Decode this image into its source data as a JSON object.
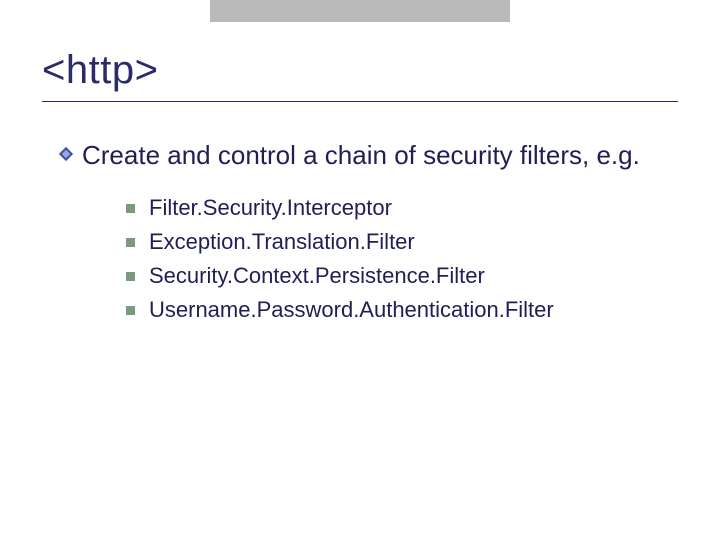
{
  "title": "<http>",
  "bullet_main": "Create and control a chain of security filters, e.g.",
  "sub_items": [
    "Filter.Security.Interceptor",
    "Exception.Translation.Filter",
    "Security.Context.Persistence.Filter",
    "Username.Password.Authentication.Filter"
  ]
}
